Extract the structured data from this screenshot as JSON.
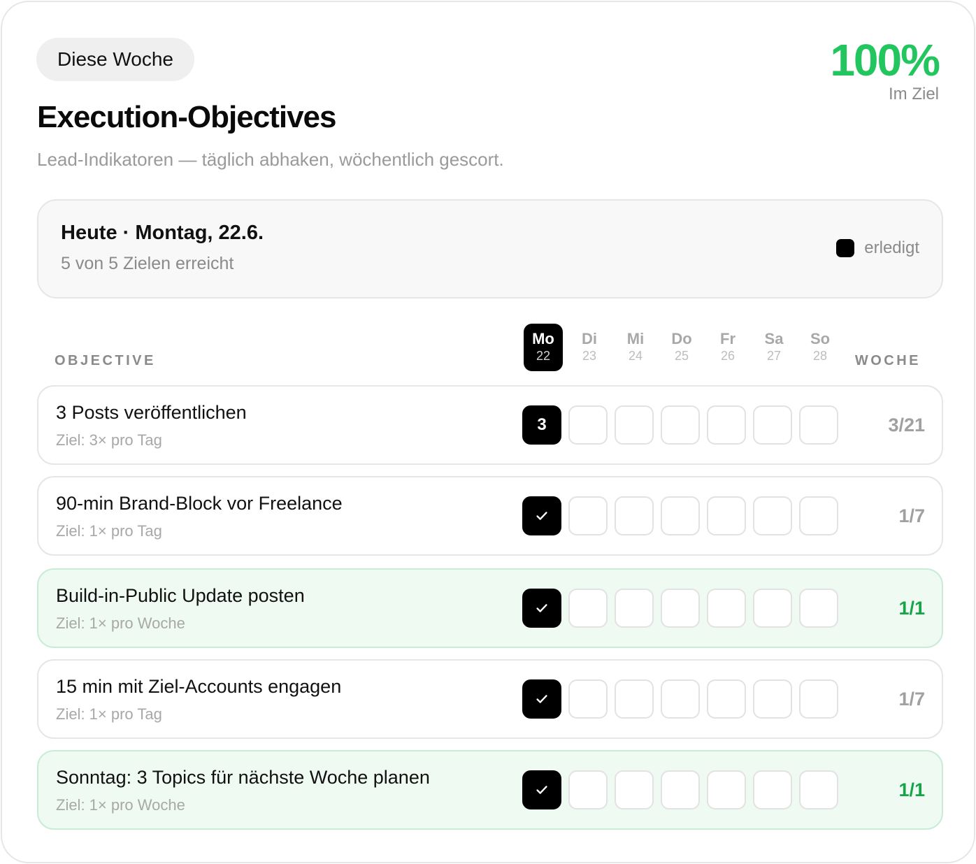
{
  "header": {
    "period_label": "Diese Woche",
    "score_value": "100%",
    "score_label": "Im Ziel",
    "title": "Execution-Objectives",
    "subtitle": "Lead-Indikatoren — täglich abhaken, wöchentlich gescort."
  },
  "today": {
    "title": "Heute · Montag, 22.6.",
    "summary": "5 von 5 Zielen erreicht",
    "legend_label": "erledigt"
  },
  "table": {
    "col_objective": "OBJECTIVE",
    "col_week": "WOCHE",
    "days": [
      {
        "name": "Mo",
        "date": "22"
      },
      {
        "name": "Di",
        "date": "23"
      },
      {
        "name": "Mi",
        "date": "24"
      },
      {
        "name": "Do",
        "date": "25"
      },
      {
        "name": "Fr",
        "date": "26"
      },
      {
        "name": "Sa",
        "date": "27"
      },
      {
        "name": "So",
        "date": "28"
      }
    ],
    "active_day_index": 0
  },
  "objectives": [
    {
      "title": "3 Posts veröffentlichen",
      "target": "Ziel: 3× pro Tag",
      "cells": [
        "3",
        "",
        "",
        "",
        "",
        "",
        ""
      ],
      "cell_types": [
        "count",
        "empty",
        "empty",
        "empty",
        "empty",
        "empty",
        "empty"
      ],
      "week": "3/21",
      "complete": false
    },
    {
      "title": "90-min Brand-Block vor Freelance",
      "target": "Ziel: 1× pro Tag",
      "cells": [
        "",
        "",
        "",
        "",
        "",
        "",
        ""
      ],
      "cell_types": [
        "check",
        "empty",
        "empty",
        "empty",
        "empty",
        "empty",
        "empty"
      ],
      "week": "1/7",
      "complete": false
    },
    {
      "title": "Build-in-Public Update posten",
      "target": "Ziel: 1× pro Woche",
      "cells": [
        "",
        "",
        "",
        "",
        "",
        "",
        ""
      ],
      "cell_types": [
        "check",
        "empty",
        "empty",
        "empty",
        "empty",
        "empty",
        "empty"
      ],
      "week": "1/1",
      "complete": true
    },
    {
      "title": "15 min mit Ziel-Accounts engagen",
      "target": "Ziel: 1× pro Tag",
      "cells": [
        "",
        "",
        "",
        "",
        "",
        "",
        ""
      ],
      "cell_types": [
        "check",
        "empty",
        "empty",
        "empty",
        "empty",
        "empty",
        "empty"
      ],
      "week": "1/7",
      "complete": false
    },
    {
      "title": "Sonntag: 3 Topics für nächste Woche planen",
      "target": "Ziel: 1× pro Woche",
      "cells": [
        "",
        "",
        "",
        "",
        "",
        "",
        ""
      ],
      "cell_types": [
        "check",
        "empty",
        "empty",
        "empty",
        "empty",
        "empty",
        "empty"
      ],
      "week": "1/1",
      "complete": true
    }
  ],
  "colors": {
    "accent_green": "#22c55e",
    "complete_text": "#16a34a",
    "complete_bg": "#effaf3",
    "filled_cell": "#000000"
  },
  "icons": {
    "check": "check-icon",
    "legend": "legend-swatch"
  }
}
